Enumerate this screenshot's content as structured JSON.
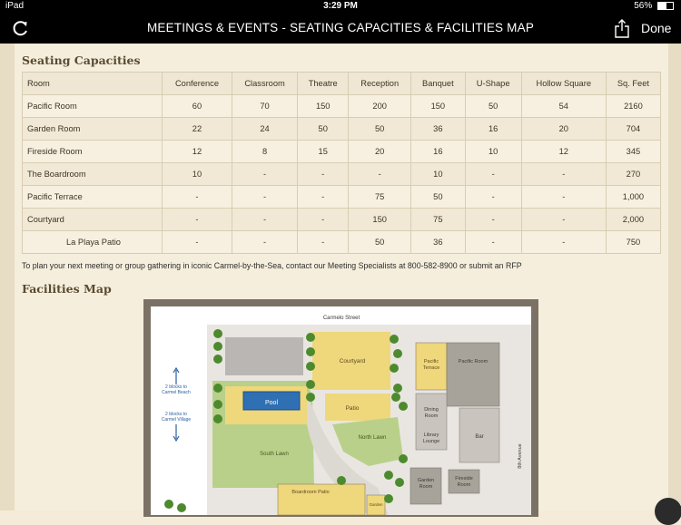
{
  "status": {
    "device": "iPad",
    "time": "3:29 PM",
    "battery": "56%"
  },
  "nav": {
    "title": "MEETINGS & EVENTS - SEATING CAPACITIES & FACILITIES MAP",
    "done": "Done"
  },
  "seating": {
    "heading": "Seating Capacities",
    "columns": [
      "Room",
      "Conference",
      "Classroom",
      "Theatre",
      "Reception",
      "Banquet",
      "U-Shape",
      "Hollow Square",
      "Sq. Feet"
    ],
    "rows": [
      [
        "Pacific Room",
        "60",
        "70",
        "150",
        "200",
        "150",
        "50",
        "54",
        "2160"
      ],
      [
        "Garden Room",
        "22",
        "24",
        "50",
        "50",
        "36",
        "16",
        "20",
        "704"
      ],
      [
        "Fireside Room",
        "12",
        "8",
        "15",
        "20",
        "16",
        "10",
        "12",
        "345"
      ],
      [
        "The Boardroom",
        "10",
        "-",
        "-",
        "-",
        "10",
        "-",
        "-",
        "270"
      ],
      [
        "Pacific Terrace",
        "-",
        "-",
        "-",
        "75",
        "50",
        "-",
        "-",
        "1,000"
      ],
      [
        "Courtyard",
        "-",
        "-",
        "-",
        "150",
        "75",
        "-",
        "-",
        "2,000"
      ],
      [
        "La Playa Patio",
        "-",
        "-",
        "-",
        "50",
        "36",
        "-",
        "-",
        "750"
      ]
    ]
  },
  "note": "To plan your next meeting or group gathering in iconic Carmel-by-the-Sea, contact our Meeting Specialists at 800-582-8900 or submit an RFP",
  "facilities": {
    "heading": "Facilities Map",
    "street_top": "Carmelo Street",
    "street_right": "8th Avenue",
    "beach_dir_1": "2 blocks to",
    "beach_dir_2": "Carmel Beach",
    "village_dir_1": "2 blocks to",
    "village_dir_2": "Carmel Village",
    "labels": {
      "courtyard": "Courtyard",
      "pool": "Pool",
      "patio": "Patio",
      "north_lawn": "North Lawn",
      "south_lawn": "South Lawn",
      "pacific_terrace_1": "Pacific",
      "pacific_terrace_2": "Terrace",
      "pacific_room": "Pacific Room",
      "dining_room_1": "Dining",
      "dining_room_2": "Room",
      "library_lounge_1": "Library",
      "library_lounge_2": "Lounge",
      "bar": "Bar",
      "garden_room_1": "Garden",
      "garden_room_2": "Room",
      "fireside_room_1": "Fireside",
      "fireside_room_2": "Room",
      "boardroom_patio": "Boardroom Patio",
      "garden_short": "Garden"
    }
  }
}
